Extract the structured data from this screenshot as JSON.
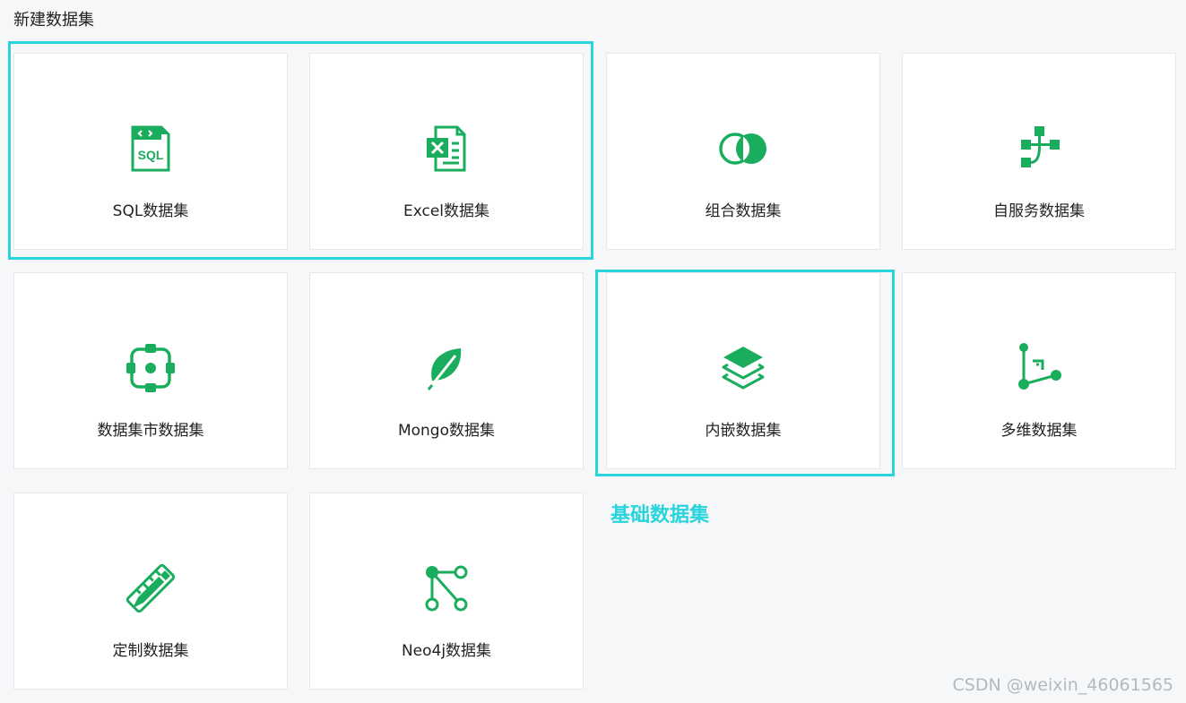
{
  "page": {
    "title": "新建数据集"
  },
  "theme": {
    "icon_color": "#1aad5d",
    "highlight_color": "#29d4dc"
  },
  "cards": [
    {
      "label": "SQL数据集",
      "icon": "sql-file-icon"
    },
    {
      "label": "Excel数据集",
      "icon": "excel-file-icon"
    },
    {
      "label": "组合数据集",
      "icon": "overlap-circles-icon"
    },
    {
      "label": "自服务数据集",
      "icon": "flow-tree-icon"
    },
    {
      "label": "数据集市数据集",
      "icon": "target-frame-icon"
    },
    {
      "label": "Mongo数据集",
      "icon": "leaf-icon"
    },
    {
      "label": "内嵌数据集",
      "icon": "layers-icon"
    },
    {
      "label": "多维数据集",
      "icon": "axis-nodes-icon"
    },
    {
      "label": "定制数据集",
      "icon": "ruler-pencil-icon"
    },
    {
      "label": "Neo4j数据集",
      "icon": "graph-nodes-icon"
    }
  ],
  "annotation": {
    "text": "基础数据集"
  },
  "watermark": {
    "text": "CSDN @weixin_46061565"
  }
}
